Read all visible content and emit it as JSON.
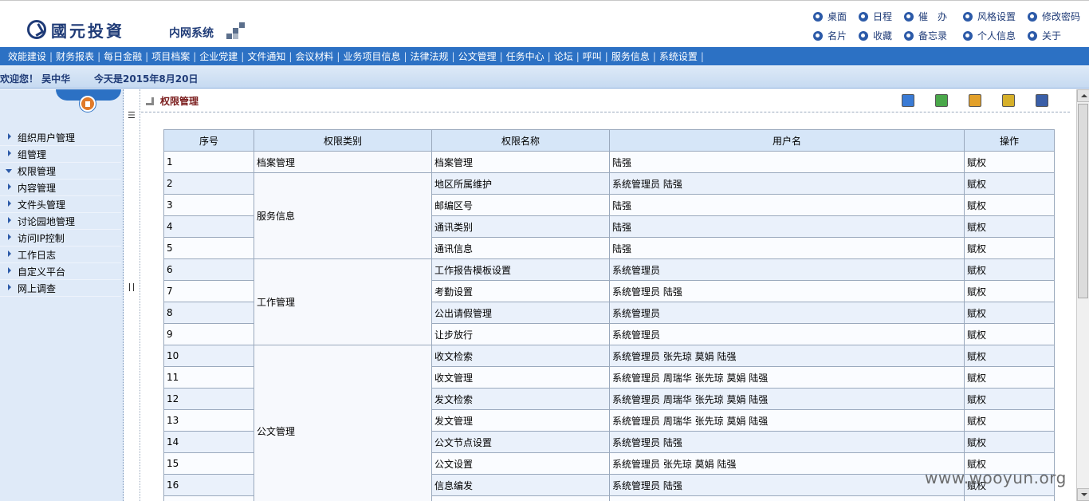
{
  "header": {
    "logo_text": "國元投資",
    "system_name": "内网系统",
    "links": [
      {
        "label": "桌面",
        "icon": "desktop-icon"
      },
      {
        "label": "日程",
        "icon": "calendar-icon"
      },
      {
        "label": "催　办",
        "icon": "urge-icon"
      },
      {
        "label": "风格设置",
        "icon": "theme-icon"
      },
      {
        "label": "修改密码",
        "icon": "password-icon"
      },
      {
        "label": "名片",
        "icon": "card-icon"
      },
      {
        "label": "收藏",
        "icon": "favorite-icon"
      },
      {
        "label": "备忘录",
        "icon": "memo-icon"
      },
      {
        "label": "个人信息",
        "icon": "profile-icon"
      },
      {
        "label": "关于",
        "icon": "about-icon"
      }
    ]
  },
  "nav": [
    "效能建设",
    "财务报表",
    "每日金融",
    "项目档案",
    "企业党建",
    "文件通知",
    "会议材料",
    "业务项目信息",
    "法律法规",
    "公文管理",
    "任务中心",
    "论坛",
    "呼叫",
    "服务信息",
    "系统设置"
  ],
  "welcome": {
    "greeting": "欢迎您！ 吴中华",
    "date": "今天是2015年8月20日"
  },
  "sidebar": {
    "items": [
      {
        "label": "组织用户管理"
      },
      {
        "label": "组管理"
      },
      {
        "label": "权限管理"
      },
      {
        "label": "内容管理"
      },
      {
        "label": "文件头管理"
      },
      {
        "label": "讨论园地管理"
      },
      {
        "label": "访问IP控制"
      },
      {
        "label": "工作日志"
      },
      {
        "label": "自定义平台"
      },
      {
        "label": "网上调查"
      }
    ],
    "open_index": 2
  },
  "content": {
    "title": "权限管理",
    "tools": [
      "grid-icon",
      "refresh-icon",
      "back-icon",
      "help-icon",
      "book-icon"
    ],
    "table": {
      "headers": [
        "序号",
        "权限类别",
        "权限名称",
        "用户名",
        "操作"
      ],
      "categories": [
        {
          "name": "档案管理",
          "count": 1
        },
        {
          "name": "服务信息",
          "count": 4
        },
        {
          "name": "工作管理",
          "count": 4
        },
        {
          "name": "公文管理",
          "count": 8
        }
      ],
      "rows": [
        {
          "no": "1",
          "name": "档案管理",
          "users": "陆强",
          "op": "赋权"
        },
        {
          "no": "2",
          "name": "地区所属维护",
          "users": "系统管理员 陆强",
          "op": "赋权"
        },
        {
          "no": "3",
          "name": "邮编区号",
          "users": "陆强",
          "op": "赋权"
        },
        {
          "no": "4",
          "name": "通讯类别",
          "users": "陆强",
          "op": "赋权"
        },
        {
          "no": "5",
          "name": "通讯信息",
          "users": "陆强",
          "op": "赋权"
        },
        {
          "no": "6",
          "name": "工作报告模板设置",
          "users": "系统管理员",
          "op": "赋权"
        },
        {
          "no": "7",
          "name": "考勤设置",
          "users": "系统管理员 陆强",
          "op": "赋权"
        },
        {
          "no": "8",
          "name": "公出请假管理",
          "users": "系统管理员",
          "op": "赋权"
        },
        {
          "no": "9",
          "name": "让步放行",
          "users": "系统管理员",
          "op": "赋权"
        },
        {
          "no": "10",
          "name": "收文检索",
          "users": "系统管理员 张先琼 莫娟 陆强",
          "op": "赋权"
        },
        {
          "no": "11",
          "name": "收文管理",
          "users": "系统管理员 周瑞华 张先琼 莫娟 陆强",
          "op": "赋权"
        },
        {
          "no": "12",
          "name": "发文检索",
          "users": "系统管理员 周瑞华 张先琼 莫娟 陆强",
          "op": "赋权"
        },
        {
          "no": "13",
          "name": "发文管理",
          "users": "系统管理员 周瑞华 张先琼 莫娟 陆强",
          "op": "赋权"
        },
        {
          "no": "14",
          "name": "公文节点设置",
          "users": "系统管理员 陆强",
          "op": "赋权"
        },
        {
          "no": "15",
          "name": "公文设置",
          "users": "系统管理员 张先琼 莫娟 陆强",
          "op": "赋权"
        },
        {
          "no": "16",
          "name": "信息编发",
          "users": "系统管理员 陆强",
          "op": "赋权"
        },
        {
          "no": "",
          "name": "",
          "users": "",
          "op": ""
        }
      ]
    }
  },
  "watermark": "www.wooyun.org"
}
